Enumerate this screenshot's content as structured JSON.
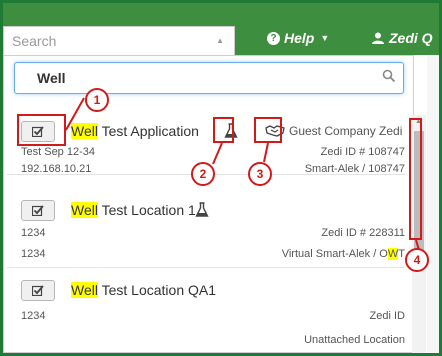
{
  "header": {
    "search_placeholder": "Search",
    "help_label": "Help",
    "help_icon": "question-circle-icon",
    "user_label": "Zedi Q"
  },
  "filter": {
    "value": "Well",
    "icon": "search-icon"
  },
  "results": [
    {
      "highlight": "Well",
      "rest": " Test Application",
      "line2_left": "Test Sep 12-34",
      "line2_right": "Zedi ID # 108747",
      "line3_left": "192.168.10.21",
      "line3_right": "Smart-Alek / 108747",
      "company": "Guest Company Zedi"
    },
    {
      "highlight": "Well",
      "rest": " Test Location 1",
      "line2_left": "1234",
      "line2_right": "Zedi ID # 228311",
      "line3_left": "1234",
      "line3_right_pre": "Virtual Smart-Alek / O",
      "line3_right_hl": "W",
      "line3_right_post": "T"
    },
    {
      "highlight": "Well",
      "rest": " Test Location QA1",
      "line2_left": "1234",
      "line2_right": "Zedi ID",
      "line3_right": "Unattached Location"
    }
  ],
  "callouts": [
    "1",
    "2",
    "3",
    "4"
  ],
  "colors": {
    "topbar": "#3e8e3f",
    "highlight": "#ffff00",
    "callout": "#d21a1a",
    "focus": "#66afe9"
  }
}
